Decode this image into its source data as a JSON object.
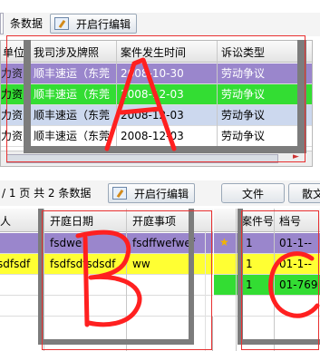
{
  "top_toolbar": {
    "count_text": "条数据",
    "edit_button": "开启行编辑"
  },
  "grid_a": {
    "columns": [
      "单位",
      "我司涉及牌照",
      "案件发生时间",
      "诉讼类型"
    ],
    "rows": [
      {
        "unit": "力资",
        "license": "顺丰速运（东莞",
        "date": "2008-10-30",
        "type": "劳动争议",
        "color": "#9a86cc"
      },
      {
        "unit": "力资",
        "license": "顺丰速运（东莞",
        "date": "2008-12-03",
        "type": "劳动争议",
        "color": "#33dd33"
      },
      {
        "unit": "力资",
        "license": "顺丰速运（东莞",
        "date": "2008-12-03",
        "type": "劳动争议",
        "color": "#ccd8ee"
      },
      {
        "unit": "力资",
        "license": "顺丰速运（东莞",
        "date": "2008-12-03",
        "type": "劳动争议",
        "color": "#ffffff"
      }
    ]
  },
  "mid_toolbar": {
    "page_prefix": "/ 1 页 共 2 条数据",
    "edit_button": "开启行编辑",
    "tab_file": "文件",
    "tab_other": "散文"
  },
  "grid_b": {
    "columns": [
      "人",
      "开庭日期",
      "开庭事项"
    ],
    "rows": [
      {
        "person": "",
        "date": "fsdwe",
        "item": "fsdffwefwef",
        "color": "#9a86cc"
      },
      {
        "person": "sdfsdf",
        "date": "fsdfsdfsdsdf",
        "item": "ww",
        "color": "#ffff33"
      },
      {
        "person": "",
        "date": "",
        "item": "",
        "color": "#ffffff"
      },
      {
        "person": "",
        "date": "",
        "item": "",
        "color": "#ffffff"
      }
    ]
  },
  "grid_c": {
    "columns": [
      "案件号",
      "档号"
    ],
    "rows": [
      {
        "star": "★",
        "num": "1",
        "code": "01-1--",
        "color": "#9a86cc"
      },
      {
        "star": "",
        "num": "1",
        "code": "01-1--",
        "color": "#ffff33"
      },
      {
        "star": "",
        "num": "1",
        "code": "01-769",
        "color": "#33dd33"
      },
      {
        "star": "",
        "num": "",
        "code": "",
        "color": "#ffffff"
      }
    ]
  },
  "annotations": {
    "a": "A",
    "b": "B",
    "c": "C",
    "ink_color": "#ff2020"
  }
}
